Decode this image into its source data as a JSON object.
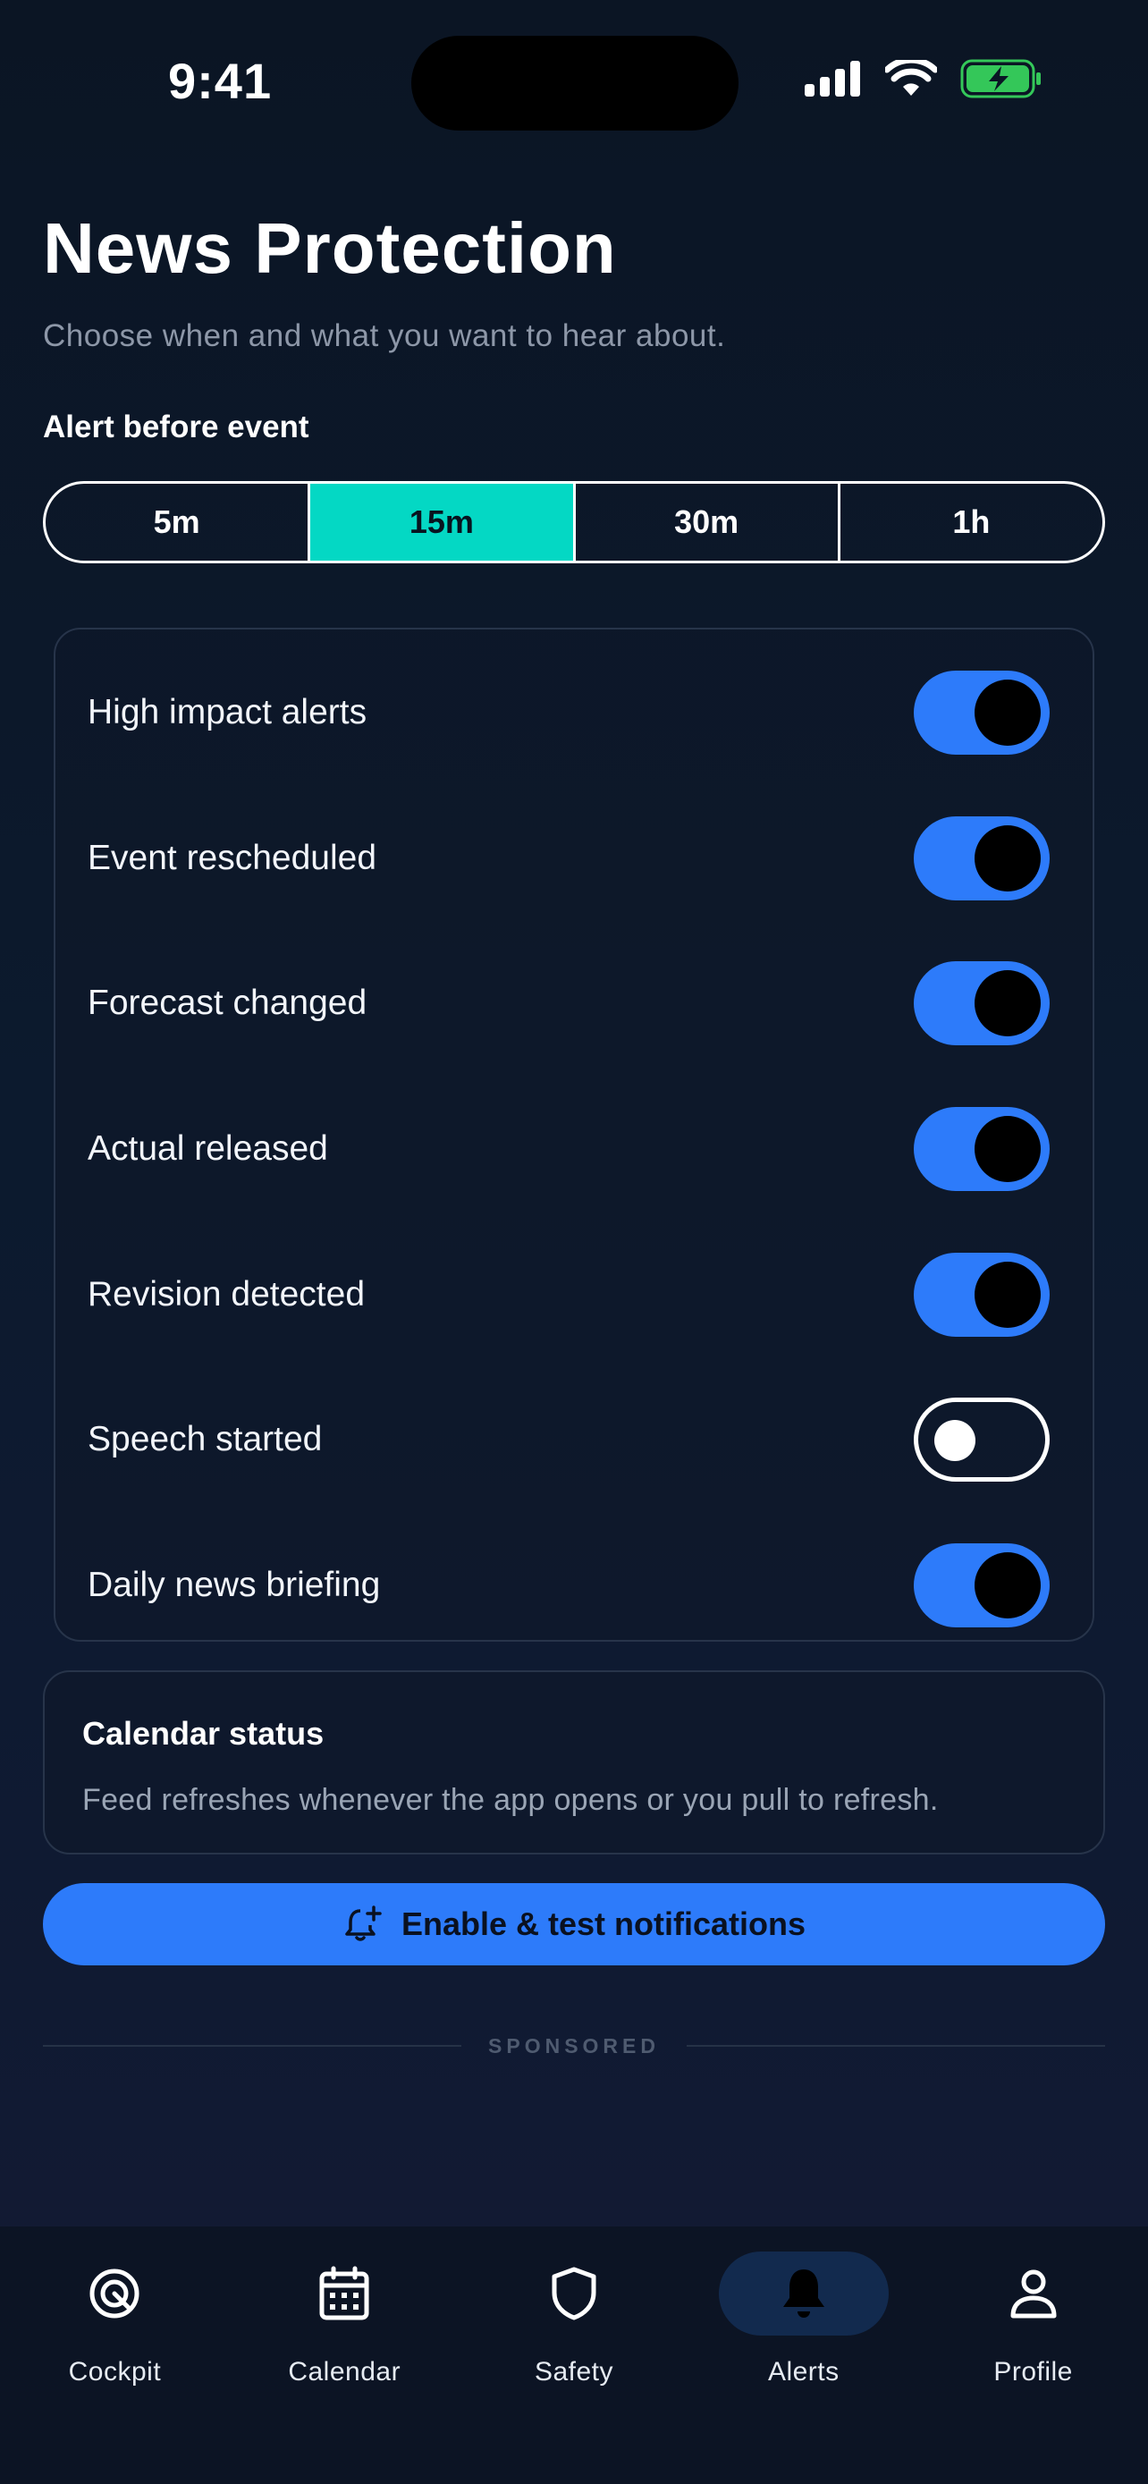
{
  "status_bar": {
    "time": "9:41"
  },
  "header": {
    "title": "News Protection",
    "subtitle": "Choose when and what you want to hear about."
  },
  "alert_before": {
    "label": "Alert before event",
    "options": [
      "5m",
      "15m",
      "30m",
      "1h"
    ],
    "selected": "15m"
  },
  "toggles": [
    {
      "label": "High impact alerts",
      "on": true
    },
    {
      "label": "Event rescheduled",
      "on": true
    },
    {
      "label": "Forecast changed",
      "on": true
    },
    {
      "label": "Actual released",
      "on": true
    },
    {
      "label": "Revision detected",
      "on": true
    },
    {
      "label": "Speech started",
      "on": false
    },
    {
      "label": "Daily news briefing",
      "on": true
    }
  ],
  "calendar_status": {
    "title": "Calendar status",
    "body": "Feed refreshes whenever the app opens or you pull to refresh."
  },
  "cta": {
    "label": "Enable & test notifications",
    "icon": "bell-plus-icon"
  },
  "sponsored": {
    "label": "SPONSORED"
  },
  "tab_bar": {
    "tabs": [
      {
        "label": "Cockpit",
        "icon": "target-icon"
      },
      {
        "label": "Calendar",
        "icon": "calendar-icon"
      },
      {
        "label": "Safety",
        "icon": "shield-icon"
      },
      {
        "label": "Alerts",
        "icon": "bell-icon",
        "active": true
      },
      {
        "label": "Profile",
        "icon": "person-icon"
      }
    ]
  },
  "colors": {
    "accent_teal": "#04d8c4",
    "accent_blue": "#2d7bfa",
    "background": "#0c1a2e",
    "battery_green": "#34c759"
  }
}
